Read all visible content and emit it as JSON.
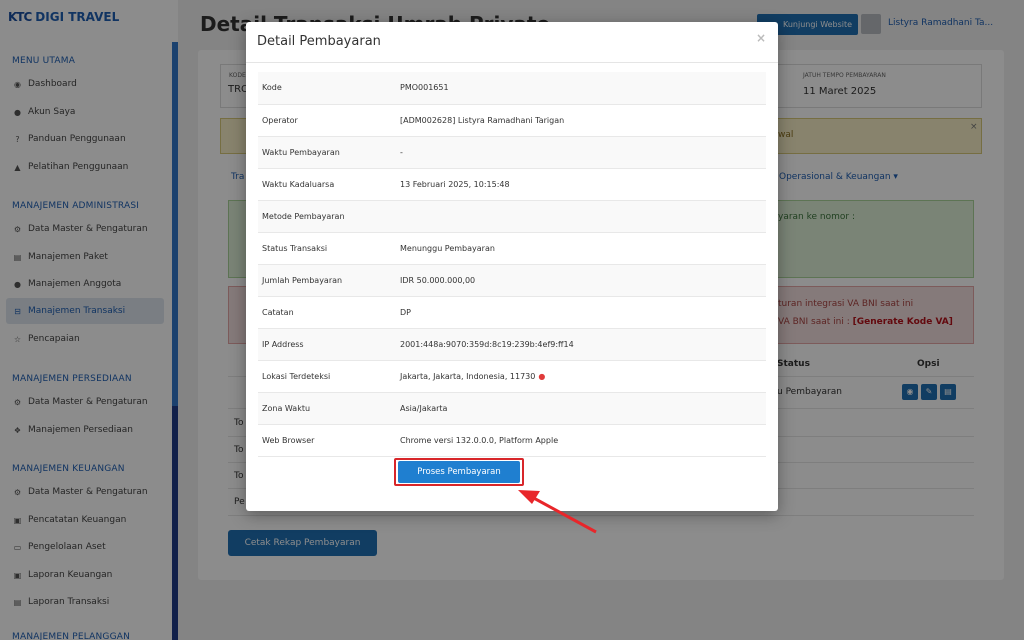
{
  "brand": {
    "logo_text": "KTC",
    "name": "DIGI TRAVEL"
  },
  "sidebar": {
    "sections": [
      {
        "title": "MENU UTAMA",
        "items": [
          {
            "label": "Dashboard",
            "icon": "dashboard-icon"
          },
          {
            "label": "Akun Saya",
            "icon": "user-icon"
          },
          {
            "label": "Panduan Penggunaan",
            "icon": "help-icon"
          },
          {
            "label": "Pelatihan Penggunaan",
            "icon": "graduation-icon"
          }
        ]
      },
      {
        "title": "MANAJEMEN ADMINISTRASI",
        "items": [
          {
            "label": "Data Master & Pengaturan",
            "icon": "gears-icon"
          },
          {
            "label": "Manajemen Paket",
            "icon": "book-icon"
          },
          {
            "label": "Manajemen Anggota",
            "icon": "users-icon"
          },
          {
            "label": "Manajemen Transaksi",
            "icon": "cart-icon",
            "active": true
          },
          {
            "label": "Pencapaian",
            "icon": "star-icon"
          }
        ]
      },
      {
        "title": "MANAJEMEN PERSEDIAAN",
        "items": [
          {
            "label": "Data Master & Pengaturan",
            "icon": "gears-icon"
          },
          {
            "label": "Manajemen Persediaan",
            "icon": "cubes-icon"
          }
        ]
      },
      {
        "title": "MANAJEMEN KEUANGAN",
        "items": [
          {
            "label": "Data Master & Pengaturan",
            "icon": "gears-icon"
          },
          {
            "label": "Pencatatan Keuangan",
            "icon": "money-icon"
          },
          {
            "label": "Pengelolaan Aset",
            "icon": "hdd-icon"
          },
          {
            "label": "Laporan Keuangan",
            "icon": "money-icon"
          },
          {
            "label": "Laporan Transaksi",
            "icon": "book-icon"
          }
        ]
      },
      {
        "title": "MANAJEMEN PELANGGAN",
        "items": []
      }
    ]
  },
  "header": {
    "page_title": "Detail Transaksi Umrah Private",
    "visit_button": "Kunjungi Website",
    "user_name": "Listyra Ramadhani Ta..."
  },
  "background": {
    "info_left_small": "KODE",
    "info_left": "TRO",
    "due_label": "JATUH TEMPO PEMBAYARAN",
    "due_value": "11 Maret 2025",
    "warn_text": "wal",
    "tab_left": "Tra",
    "tab_right": "Operasional & Keuangan ▾",
    "green_text": "yaran ke nomor :",
    "red_text1": "turan integrasi VA BNI saat ini",
    "red_text2_prefix": "VA BNI saat ini : ",
    "red_text2_link": "[Generate Kode VA]",
    "th_status": "Status",
    "th_opsi": "Opsi",
    "td_status": "u Pembayaran",
    "total_rows": [
      "To",
      "To",
      "To",
      "Pe"
    ],
    "rekap_button": "Cetak Rekap Pembayaran"
  },
  "modal": {
    "title": "Detail Pembayaran",
    "close": "×",
    "rows": [
      {
        "key": "Kode",
        "value": "PMO001651"
      },
      {
        "key": "Operator",
        "value": "[ADM002628] Listyra Ramadhani Tarigan"
      },
      {
        "key": "Waktu Pembayaran",
        "value": "-"
      },
      {
        "key": "Waktu Kadaluarsa",
        "value": "13 Februari 2025, 10:15:48"
      },
      {
        "key": "Metode Pembayaran",
        "value": ""
      },
      {
        "key": "Status Transaksi",
        "value": "Menunggu Pembayaran"
      },
      {
        "key": "Jumlah Pembayaran",
        "value": "IDR 50.000.000,00"
      },
      {
        "key": "Catatan",
        "value": "DP"
      },
      {
        "key": "IP Address",
        "value": "2001:448a:9070:359d:8c19:239b:4ef9:ff14"
      },
      {
        "key": "Lokasi Terdeteksi",
        "value": "Jakarta, Jakarta, Indonesia, 11730"
      },
      {
        "key": "Zona Waktu",
        "value": "Asia/Jakarta"
      },
      {
        "key": "Web Browser",
        "value": "Chrome versi 132.0.0.0, Platform Apple"
      }
    ],
    "process_button": "Proses Pembayaran"
  },
  "colors": {
    "primary": "#1f6fb3",
    "highlight_red": "#d8262a"
  }
}
